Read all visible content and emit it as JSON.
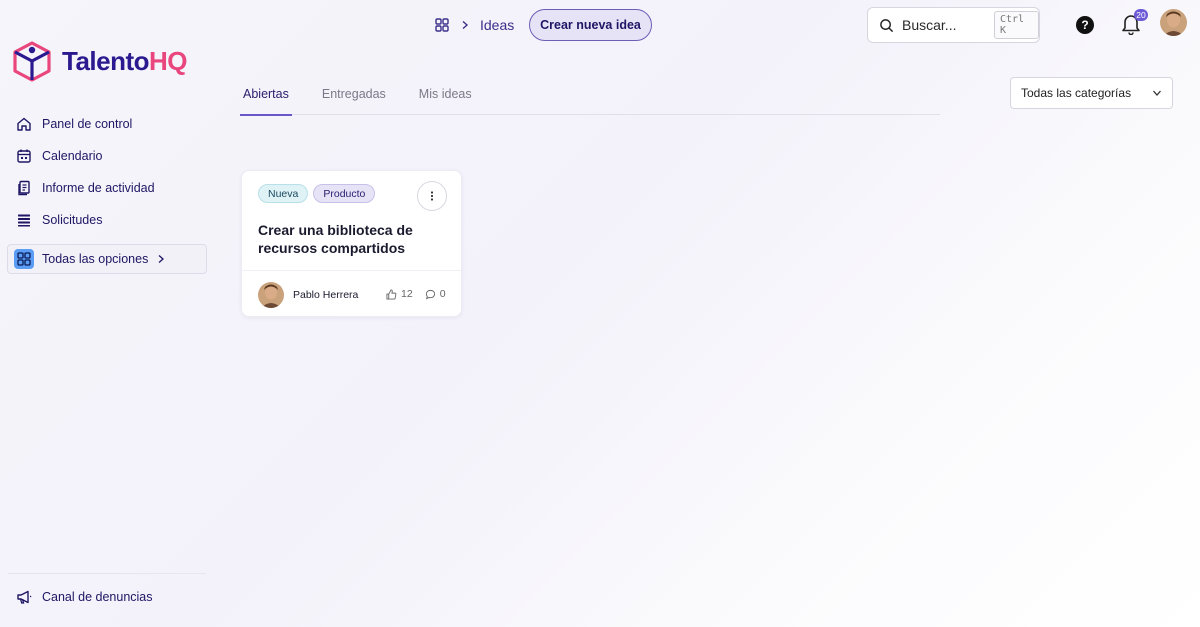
{
  "brand": {
    "name_part1": "Talento",
    "name_part2": "HQ",
    "logo_icon": "cube-person-logo",
    "color_primary": "#2b1a8f",
    "color_accent": "#e8467c"
  },
  "sidebar": {
    "items": [
      {
        "label": "Panel de control",
        "icon": "home-icon"
      },
      {
        "label": "Calendario",
        "icon": "calendar-icon"
      },
      {
        "label": "Informe de actividad",
        "icon": "report-icon"
      },
      {
        "label": "Solicitudes",
        "icon": "list-icon"
      }
    ],
    "all_options": {
      "label": "Todas las opciones",
      "icon": "grid-icon"
    },
    "footer": {
      "label": "Canal de denuncias",
      "icon": "megaphone-icon"
    }
  },
  "header": {
    "breadcrumb": {
      "icon": "grid-icon",
      "current": "Ideas"
    },
    "create_button": "Crear nueva idea",
    "search": {
      "placeholder": "Buscar...",
      "shortcut": "Ctrl K"
    },
    "notifications": {
      "count": "20"
    }
  },
  "tabs": [
    {
      "label": "Abiertas",
      "active": true
    },
    {
      "label": "Entregadas",
      "active": false
    },
    {
      "label": "Mis ideas",
      "active": false
    }
  ],
  "filter": {
    "selected": "Todas las categorías"
  },
  "cards": [
    {
      "tags": [
        "Nueva",
        "Producto"
      ],
      "title": "Crear una biblioteca de recursos compartidos",
      "author": "Pablo Herrera",
      "likes": "12",
      "comments": "0"
    }
  ],
  "colors": {
    "accent": "#6a55c9",
    "tag_new_bg": "#dff2f5",
    "tag_product_bg": "#e6e3f7"
  }
}
